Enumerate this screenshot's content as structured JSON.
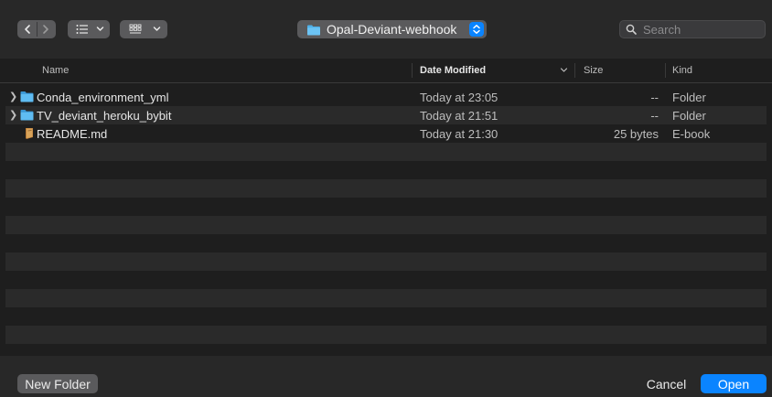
{
  "toolbar": {
    "path_label": "Opal-Deviant-webhook",
    "search_placeholder": "Search"
  },
  "columns": {
    "name": "Name",
    "date_modified": "Date Modified",
    "size": "Size",
    "kind": "Kind"
  },
  "files": [
    {
      "name": "Conda_environment_yml",
      "date": "Today at 23:05",
      "size": "--",
      "kind": "Folder",
      "icon": "folder-icon",
      "expandable": true
    },
    {
      "name": "TV_deviant_heroku_bybit",
      "date": "Today at 21:51",
      "size": "--",
      "kind": "Folder",
      "icon": "folder-icon",
      "expandable": true
    },
    {
      "name": "README.md",
      "date": "Today at 21:30",
      "size": "25 bytes",
      "kind": "E-book",
      "icon": "ebook-icon",
      "expandable": false
    }
  ],
  "footer": {
    "new_folder": "New Folder",
    "cancel": "Cancel",
    "open": "Open"
  },
  "colors": {
    "accent": "#0a84ff",
    "folder": "#4fb1ea"
  }
}
